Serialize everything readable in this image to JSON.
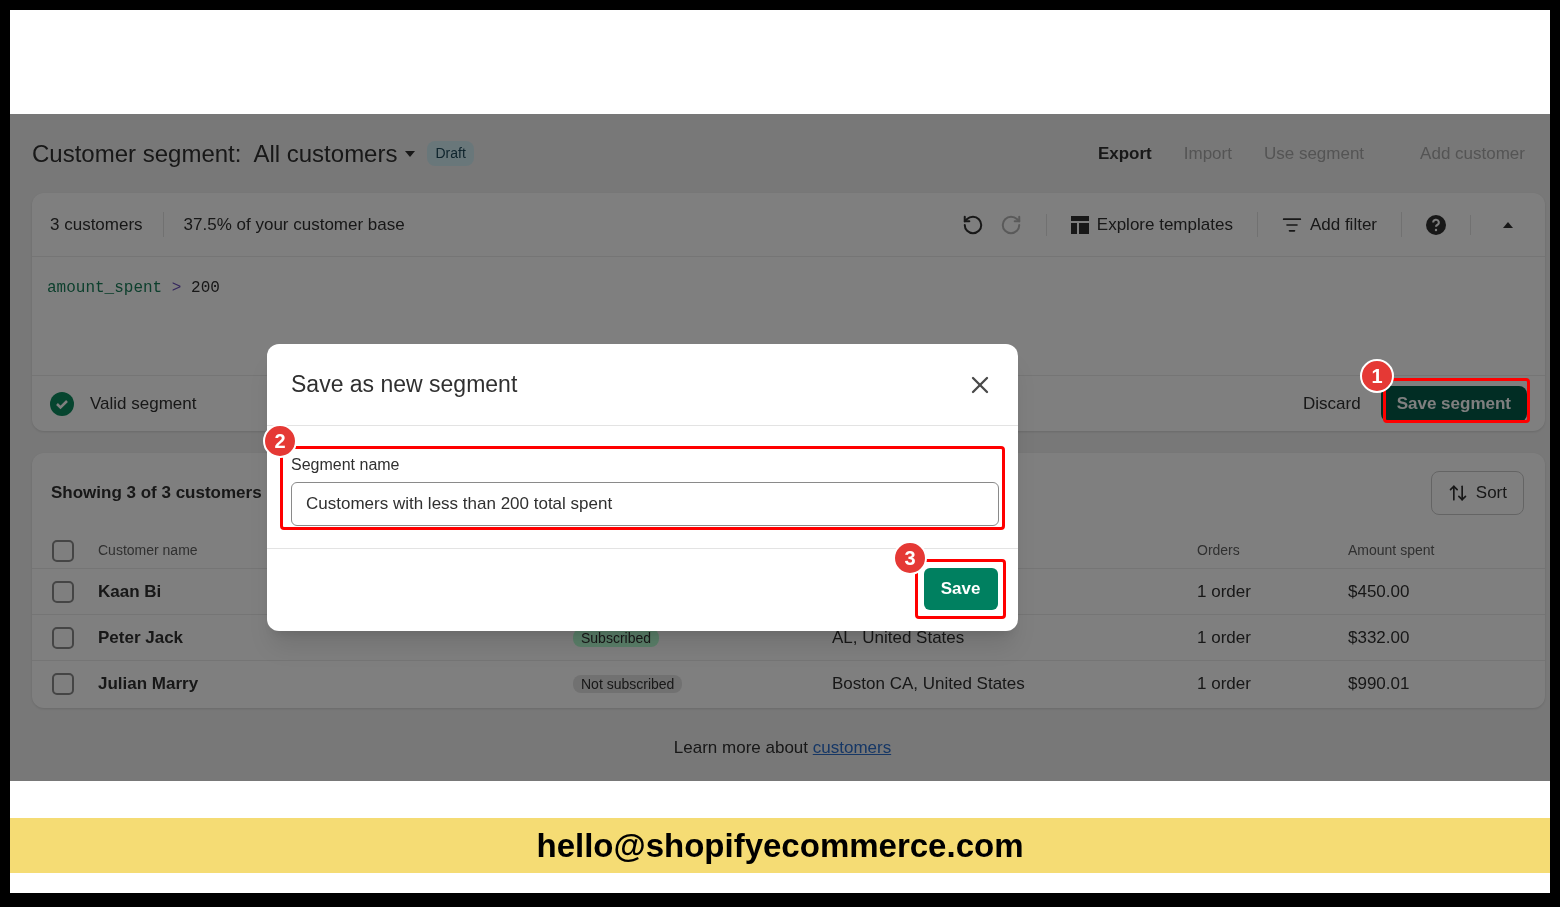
{
  "header": {
    "title_prefix": "Customer segment:",
    "title": "All customers",
    "status": "Draft",
    "actions": [
      {
        "label": "Export",
        "disabled": false
      },
      {
        "label": "Import",
        "disabled": true
      },
      {
        "label": "Use segment",
        "disabled": true
      },
      {
        "label": "Add customer",
        "disabled": true
      }
    ]
  },
  "editor": {
    "customer_count": "3 customers",
    "share": "37.5% of your customer base",
    "tools": [
      {
        "kind": "undo",
        "disabled": false
      },
      {
        "kind": "redo",
        "disabled": true
      },
      {
        "kind": "templates",
        "label": "Explore templates"
      },
      {
        "kind": "filter",
        "label": "Add filter"
      },
      {
        "kind": "help"
      },
      {
        "kind": "collapse"
      }
    ],
    "query": {
      "field": "amount_spent",
      "operator": ">",
      "value": "200"
    },
    "validation": {
      "valid": true,
      "label": "Valid segment"
    },
    "discard": "Discard",
    "save": "Save segment"
  },
  "table": {
    "summary": "Showing 3 of 3 customers",
    "sort": "Sort",
    "all_checked": false,
    "column_headers": {
      "customer_name": "Customer name",
      "orders": "Orders",
      "amount_spent": "Amount spent"
    },
    "rows": [
      {
        "name": "Kaan Bi",
        "checked": false,
        "orders": "1 order",
        "amount": "$450.00"
      },
      {
        "name": "Peter Jack",
        "checked": false,
        "subscription": {
          "label": "Subscribed",
          "kind": "subscribed"
        },
        "location": "AL, United States",
        "orders": "1 order",
        "amount": "$332.00"
      },
      {
        "name": "Julian Marry",
        "checked": false,
        "subscription": {
          "label": "Not subscribed",
          "kind": "not_subscribed"
        },
        "location": "Boston CA, United States",
        "orders": "1 order",
        "amount": "$990.01"
      }
    ]
  },
  "footer_note": {
    "text": "Learn more about",
    "link": "customers"
  },
  "dialog": {
    "title": "Save as new segment",
    "field_label": "Segment name",
    "field_value": "Customers with less than 200 total spent",
    "save": "Save"
  },
  "steps": [
    {
      "number": "1"
    },
    {
      "number": "2"
    },
    {
      "number": "3"
    }
  ],
  "banner": {
    "email": "hello@shopifyecommerce.com"
  }
}
